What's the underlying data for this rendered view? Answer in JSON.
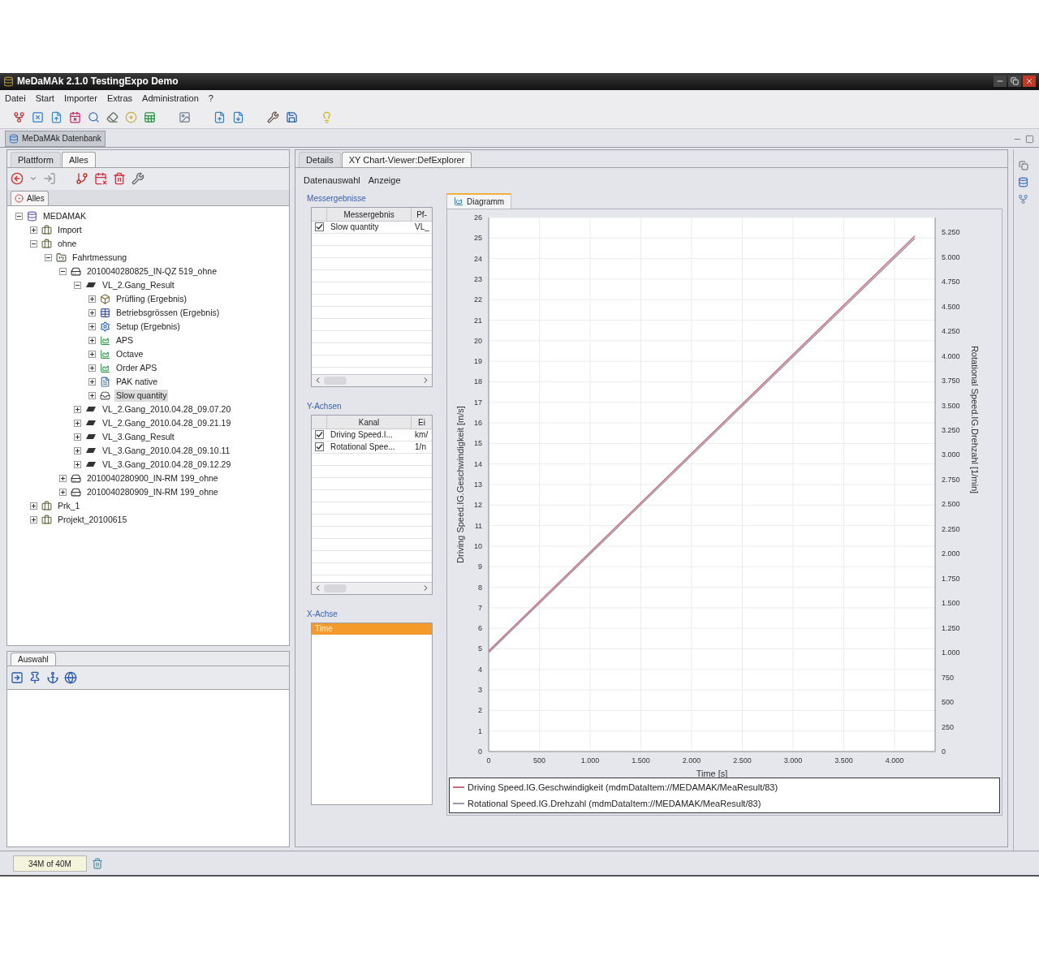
{
  "window": {
    "title": "MeDaMAk 2.1.0 TestingExpo Demo"
  },
  "menu": [
    "Datei",
    "Start",
    "Importer",
    "Extras",
    "Administration",
    "?"
  ],
  "perspective_tab": {
    "label": "MeDaMAk Datenbank"
  },
  "left_panel": {
    "tabs": [
      {
        "label": "Plattform",
        "selected": false
      },
      {
        "label": "Alles",
        "selected": true
      }
    ],
    "view_tab": {
      "label": "Alles"
    },
    "tree": [
      {
        "label": "MEDAMAK",
        "kind": "database",
        "expanded": true,
        "selected": false,
        "children": [
          {
            "label": "Import",
            "kind": "folder",
            "expanded": false,
            "selected": false
          },
          {
            "label": "ohne",
            "kind": "folder",
            "expanded": true,
            "selected": false,
            "children": [
              {
                "label": "Fahrtmessung",
                "kind": "project",
                "expanded": true,
                "selected": false,
                "children": [
                  {
                    "label": "2010040280825_IN-QZ 519_ohne",
                    "kind": "measurement",
                    "expanded": true,
                    "selected": false,
                    "children": [
                      {
                        "label": "VL_2.Gang_Result",
                        "kind": "test",
                        "expanded": true,
                        "selected": false,
                        "children": [
                          {
                            "label": "Prüfling (Ergebnis)",
                            "kind": "unit",
                            "expanded": false,
                            "selected": false
                          },
                          {
                            "label": "Betriebsgrössen (Ergebnis)",
                            "kind": "table",
                            "expanded": false,
                            "selected": false
                          },
                          {
                            "label": "Setup (Ergebnis)",
                            "kind": "setup",
                            "expanded": false,
                            "selected": false
                          },
                          {
                            "label": "APS",
                            "kind": "chart",
                            "expanded": false,
                            "selected": false
                          },
                          {
                            "label": "Octave",
                            "kind": "chart",
                            "expanded": false,
                            "selected": false
                          },
                          {
                            "label": "Order APS",
                            "kind": "chart",
                            "expanded": false,
                            "selected": false
                          },
                          {
                            "label": "PAK native",
                            "kind": "pak",
                            "expanded": false,
                            "selected": false
                          },
                          {
                            "label": "Slow quantity",
                            "kind": "slow",
                            "expanded": false,
                            "selected": true
                          }
                        ]
                      },
                      {
                        "label": "VL_2.Gang_2010.04.28_09.07.20",
                        "kind": "test",
                        "expanded": false,
                        "selected": false
                      },
                      {
                        "label": "VL_2.Gang_2010.04.28_09.21.19",
                        "kind": "test",
                        "expanded": false,
                        "selected": false
                      },
                      {
                        "label": "VL_3.Gang_Result",
                        "kind": "test",
                        "expanded": false,
                        "selected": false
                      },
                      {
                        "label": "VL_3.Gang_2010.04.28_09.10.11",
                        "kind": "test",
                        "expanded": false,
                        "selected": false
                      },
                      {
                        "label": "VL_3.Gang_2010.04.28_09.12.29",
                        "kind": "test",
                        "expanded": false,
                        "selected": false
                      }
                    ]
                  },
                  {
                    "label": "2010040280900_IN-RM 199_ohne",
                    "kind": "measurement",
                    "expanded": false,
                    "selected": false
                  },
                  {
                    "label": "2010040280909_IN-RM 199_ohne",
                    "kind": "measurement",
                    "expanded": false,
                    "selected": false
                  }
                ]
              }
            ]
          },
          {
            "label": "Prk_1",
            "kind": "folder",
            "expanded": false,
            "selected": false
          },
          {
            "label": "Projekt_20100615",
            "kind": "folder",
            "expanded": false,
            "selected": false
          }
        ]
      }
    ]
  },
  "selection_panel": {
    "tab": "Auswahl"
  },
  "editor": {
    "tabs": [
      {
        "label": "Details",
        "selected": false
      },
      {
        "label": "XY Chart-Viewer:DefExplorer",
        "selected": true
      }
    ],
    "links": [
      "Datenauswahl",
      "Anzeige"
    ],
    "results": {
      "heading": "Messergebnisse",
      "columns": [
        "Messergebnis",
        "Pf-"
      ],
      "rows": [
        {
          "checked": true,
          "cells": [
            "Slow quantity",
            "VL_"
          ]
        }
      ]
    },
    "y_axes": {
      "heading": "Y-Achsen",
      "columns": [
        "Kanal",
        "Ei"
      ],
      "rows": [
        {
          "checked": true,
          "cells": [
            "Driving Speed.I...",
            "km/"
          ]
        },
        {
          "checked": true,
          "cells": [
            "Rotational Spee...",
            "1/n"
          ]
        }
      ]
    },
    "x_axis": {
      "heading": "X-Achse",
      "items": [
        {
          "label": "Time",
          "selected": true
        }
      ]
    },
    "chart": {
      "tab": "Diagramm",
      "chart_data": {
        "type": "line",
        "xlabel": "Time [s]",
        "ylabel": "Driving Speed.IG.Geschwindigkeit [m/s]",
        "y2label": "Rotational Speed.IG.Drehzahl [1/min]",
        "grid": true,
        "x": [
          0,
          4200
        ],
        "y2lim": [
          0,
          5400
        ],
        "y2ticks": [
          0,
          {
            "value": 250,
            "label": "250"
          },
          {
            "value": 500,
            "label": "500"
          },
          {
            "value": 750,
            "label": "750"
          },
          {
            "value": 1000,
            "label": "1.000"
          },
          {
            "value": 1250,
            "label": "1.250"
          },
          {
            "value": 1500,
            "label": "1.500"
          },
          {
            "value": 1750,
            "label": "1.750"
          },
          {
            "value": 2000,
            "label": "2.000"
          },
          {
            "value": 2250,
            "label": "2.250"
          },
          {
            "value": 2500,
            "label": "2.500"
          },
          {
            "value": 2750,
            "label": "2.750"
          },
          {
            "value": 3000,
            "label": "3.000"
          },
          {
            "value": 3250,
            "label": "3.250"
          },
          {
            "value": 3500,
            "label": "3.500"
          },
          {
            "value": 3750,
            "label": "3.750"
          },
          {
            "value": 4000,
            "label": "4.000"
          },
          {
            "value": 4250,
            "label": "4.250"
          },
          {
            "value": 4500,
            "label": "4.500"
          },
          {
            "value": 4750,
            "label": "4.750"
          },
          {
            "value": 5000,
            "label": "5.000"
          },
          {
            "value": 5250,
            "label": "5.250"
          }
        ],
        "series": [
          {
            "name": "Driving Speed.IG.Geschwindigkeit (mdmDataItem://MEDAMAK/MeaResult/83)",
            "color": "#c8707f",
            "values": [
              4.9,
              25.1
            ]
          },
          {
            "name": "Rotational Speed.IG.Drehzahl (mdmDataItem://MEDAMAK/MeaResult/83)",
            "color": "#9a9aae",
            "values": [
              1000,
              5190
            ],
            "axis": "y2"
          }
        ],
        "xlim": [
          0,
          4400
        ],
        "ylim": [
          0,
          26
        ],
        "xticks": [
          0,
          {
            "value": 500,
            "label": "500"
          },
          {
            "value": 1000,
            "label": "1.000"
          },
          {
            "value": 1500,
            "label": "1.500"
          },
          {
            "value": 2000,
            "label": "2.000"
          },
          {
            "value": 2500,
            "label": "2.500"
          },
          {
            "value": 3000,
            "label": "3.000"
          },
          {
            "value": 3500,
            "label": "3.500"
          },
          {
            "value": 4000,
            "label": "4.000"
          }
        ],
        "yticks": [
          0,
          1,
          2,
          3,
          4,
          5,
          6,
          7,
          8,
          9,
          10,
          11,
          12,
          13,
          14,
          15,
          16,
          17,
          18,
          19,
          20,
          21,
          22,
          23,
          24,
          25,
          26
        ]
      }
    }
  },
  "status_bar": {
    "memory": "34M of 40M"
  }
}
